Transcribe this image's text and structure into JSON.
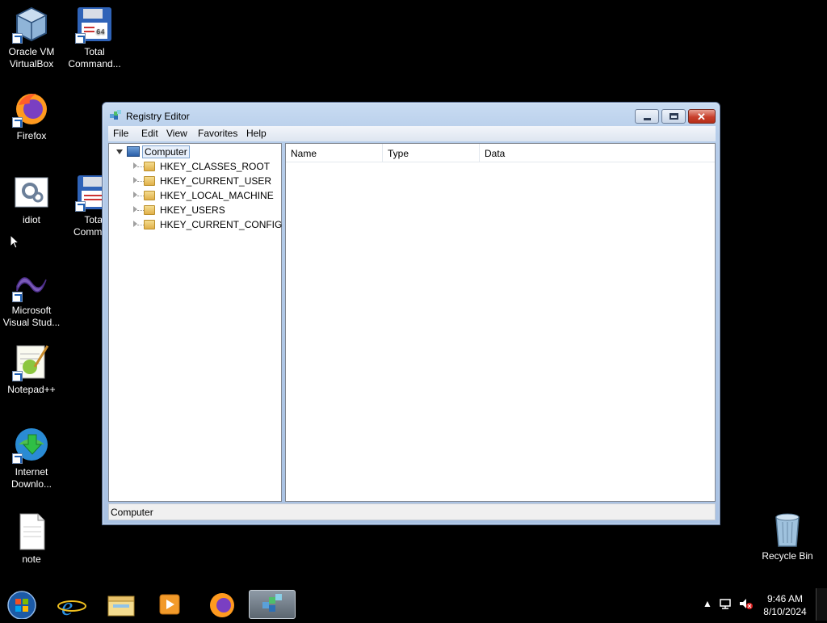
{
  "desktop": {
    "icons": [
      {
        "label": "Oracle VM VirtualBox",
        "icon": "virtualbox-icon"
      },
      {
        "label": "Total Command...",
        "icon": "total-commander-icon"
      },
      {
        "label": "Firefox",
        "icon": "firefox-icon"
      },
      {
        "label": "idiot",
        "icon": "settings-file-icon"
      },
      {
        "label": "Total Comma...",
        "icon": "total-commander-icon"
      },
      {
        "label": "Microsoft Visual Stud...",
        "icon": "visual-studio-icon"
      },
      {
        "label": "Notepad++",
        "icon": "notepadpp-icon"
      },
      {
        "label": "Internet Downlo...",
        "icon": "idm-icon"
      },
      {
        "label": "note",
        "icon": "text-file-icon"
      },
      {
        "label": "Recycle Bin",
        "icon": "recycle-bin-icon"
      }
    ]
  },
  "window": {
    "title": "Registry Editor",
    "menu": [
      "File",
      "Edit",
      "View",
      "Favorites",
      "Help"
    ],
    "tree": {
      "root": "Computer",
      "children": [
        "HKEY_CLASSES_ROOT",
        "HKEY_CURRENT_USER",
        "HKEY_LOCAL_MACHINE",
        "HKEY_USERS",
        "HKEY_CURRENT_CONFIG"
      ]
    },
    "columns": [
      "Name",
      "Type",
      "Data"
    ],
    "status": "Computer"
  },
  "taskbar": {
    "apps": [
      "start-orb-icon",
      "internet-explorer-icon",
      "file-explorer-icon",
      "media-player-icon",
      "firefox-icon",
      "registry-editor-icon"
    ],
    "clock": {
      "time": "9:46 AM",
      "date": "8/10/2024"
    }
  },
  "colors": {
    "titlebar": "#b6cdea",
    "close_button": "#c8402c",
    "selection": "#e8f0fb"
  }
}
